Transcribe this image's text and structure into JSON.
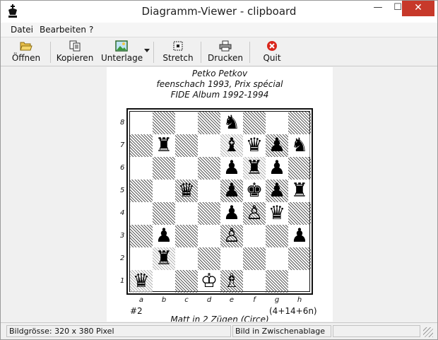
{
  "window": {
    "title": "Diagramm-Viewer - clipboard",
    "controls": {
      "minimize": "—",
      "maximize": "☐",
      "close": "✕"
    }
  },
  "menu": [
    "Datei",
    "Bearbeiten",
    "?"
  ],
  "toolbar": {
    "open": "Öffnen",
    "copy": "Kopieren",
    "background": "Unterlage",
    "stretch": "Stretch",
    "print": "Drucken",
    "quit": "Quit"
  },
  "diagram": {
    "author": "Petko Petkov",
    "source": "feenschach 1993, Prix spécial",
    "album": "FIDE Album 1992-1994",
    "ranks": [
      "8",
      "7",
      "6",
      "5",
      "4",
      "3",
      "2",
      "1"
    ],
    "files": [
      "a",
      "b",
      "c",
      "d",
      "e",
      "f",
      "g",
      "h"
    ],
    "number": "#2",
    "count": "(4+14+6n)",
    "stipulation": "Matt in 2 Zügen (Circe)",
    "pieces": [
      {
        "sq": "e8",
        "glyph": "♞",
        "kind": "black"
      },
      {
        "sq": "b7",
        "glyph": "♜",
        "kind": "neutral"
      },
      {
        "sq": "e7",
        "glyph": "♝",
        "kind": "neutral"
      },
      {
        "sq": "f7",
        "glyph": "♛",
        "kind": "neutral"
      },
      {
        "sq": "g7",
        "glyph": "♟",
        "kind": "black"
      },
      {
        "sq": "h7",
        "glyph": "♞",
        "kind": "neutral"
      },
      {
        "sq": "e6",
        "glyph": "♟",
        "kind": "black"
      },
      {
        "sq": "f6",
        "glyph": "♜",
        "kind": "neutral"
      },
      {
        "sq": "g6",
        "glyph": "♟",
        "kind": "black"
      },
      {
        "sq": "c5",
        "glyph": "♛",
        "kind": "black"
      },
      {
        "sq": "e5",
        "glyph": "♟",
        "kind": "black"
      },
      {
        "sq": "f5",
        "glyph": "♚",
        "kind": "black"
      },
      {
        "sq": "g5",
        "glyph": "♟",
        "kind": "black"
      },
      {
        "sq": "h5",
        "glyph": "♜",
        "kind": "neutral"
      },
      {
        "sq": "e4",
        "glyph": "♟",
        "kind": "black"
      },
      {
        "sq": "f4",
        "glyph": "♙",
        "kind": "white"
      },
      {
        "sq": "g4",
        "glyph": "♛",
        "kind": "black"
      },
      {
        "sq": "b3",
        "glyph": "♟",
        "kind": "black"
      },
      {
        "sq": "e3",
        "glyph": "♙",
        "kind": "white"
      },
      {
        "sq": "h3",
        "glyph": "♟",
        "kind": "black"
      },
      {
        "sq": "b2",
        "glyph": "♜",
        "kind": "neutral"
      },
      {
        "sq": "a1",
        "glyph": "♛",
        "kind": "neutral"
      },
      {
        "sq": "d1",
        "glyph": "♔",
        "kind": "white"
      },
      {
        "sq": "e1",
        "glyph": "♗",
        "kind": "white"
      }
    ]
  },
  "status": {
    "size": "Bildgrösse: 320 x 380 Pixel",
    "clipboard": "Bild in Zwischenablage"
  }
}
